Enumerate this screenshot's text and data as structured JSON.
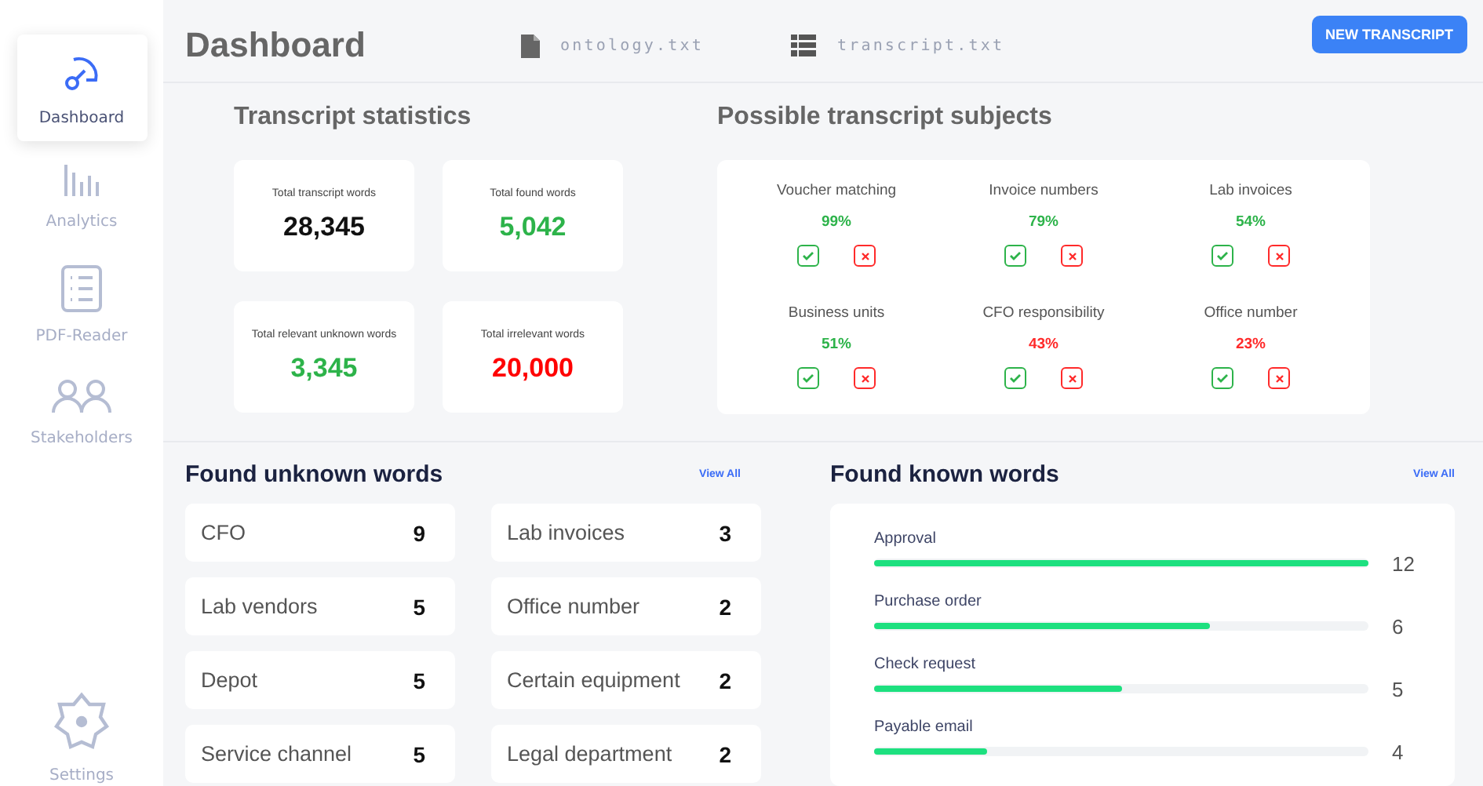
{
  "sidebar": {
    "items": [
      {
        "label": "Dashboard",
        "selected": true
      },
      {
        "label": "Analytics",
        "selected": false
      },
      {
        "label": "PDF-Reader",
        "selected": false
      },
      {
        "label": "Stakeholders",
        "selected": false
      }
    ],
    "settings": {
      "label": "Settings",
      "selected": false
    }
  },
  "header": {
    "title": "Dashboard",
    "files": [
      {
        "name": "ontology.txt"
      },
      {
        "name": "transcript.txt"
      }
    ],
    "button": "NEW TRANSCRIPT"
  },
  "statistics": {
    "title": "Transcript statistics",
    "cards": [
      {
        "label": "Total transcript words",
        "value": "28,345",
        "color": "#111111"
      },
      {
        "label": "Total found words",
        "value": "5,042",
        "color": "#2db34a"
      },
      {
        "label": "Total relevant unknown words",
        "value": "3,345",
        "color": "#2db34a"
      },
      {
        "label": "Total irrelevant words",
        "value": "20,000",
        "color": "#ff0000"
      }
    ]
  },
  "subjects": {
    "title": "Possible transcript subjects",
    "items": [
      {
        "name": "Voucher matching",
        "percent": "99%",
        "color": "#2db34a"
      },
      {
        "name": "Invoice numbers",
        "percent": "79%",
        "color": "#2db34a"
      },
      {
        "name": "Lab invoices",
        "percent": "54%",
        "color": "#2db34a"
      },
      {
        "name": "Business units",
        "percent": "51%",
        "color": "#2db34a"
      },
      {
        "name": "CFO responsibility",
        "percent": "43%",
        "color": "#ff2a2a"
      },
      {
        "name": "Office number",
        "percent": "23%",
        "color": "#ff2a2a"
      }
    ]
  },
  "unknown_words": {
    "title": "Found unknown words",
    "link": "View All",
    "items": [
      {
        "word": "CFO",
        "count": "9"
      },
      {
        "word": "Lab invoices",
        "count": "3"
      },
      {
        "word": "Lab vendors",
        "count": "5"
      },
      {
        "word": "Office number",
        "count": "2"
      },
      {
        "word": "Depot",
        "count": "5"
      },
      {
        "word": "Certain equipment",
        "count": "2"
      },
      {
        "word": "Service channel",
        "count": "5"
      },
      {
        "word": "Legal department",
        "count": "2"
      }
    ]
  },
  "known_words": {
    "title": "Found known words",
    "link": "View All",
    "items": [
      {
        "word": "Approval",
        "count": "12",
        "level": 1.0
      },
      {
        "word": "Purchase order",
        "count": "6",
        "level": 0.68
      },
      {
        "word": "Check request",
        "count": "5",
        "level": 0.5
      },
      {
        "word": "Payable email",
        "count": "4",
        "level": 0.23
      }
    ]
  }
}
